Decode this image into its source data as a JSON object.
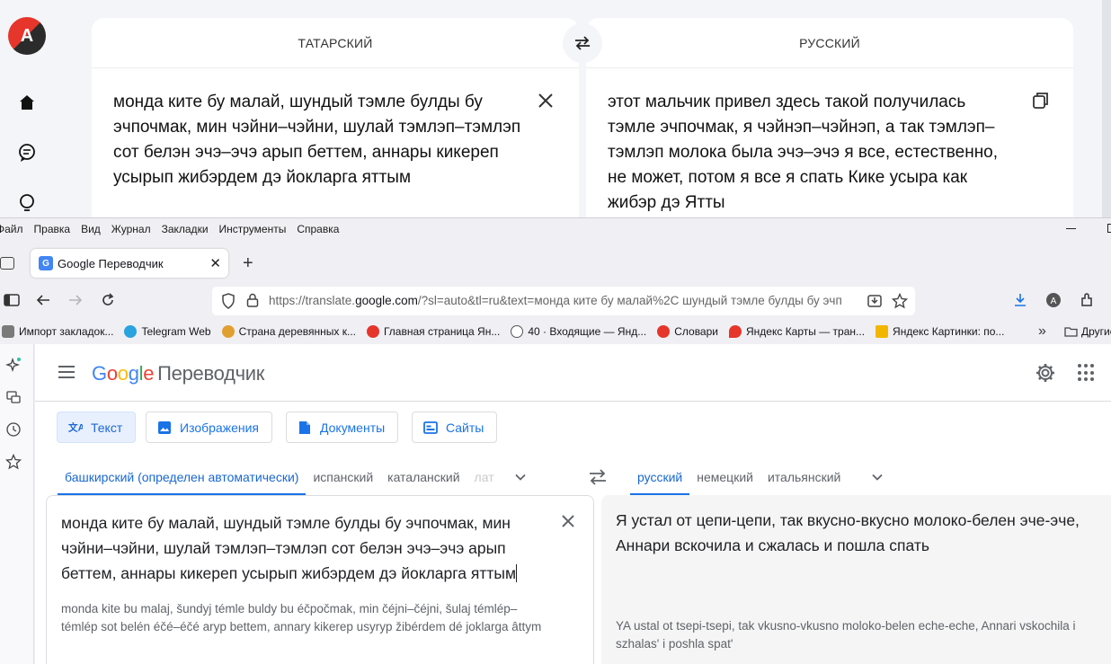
{
  "yandex": {
    "source_lang": "ТАТАРСКИЙ",
    "target_lang": "РУССКИЙ",
    "source_text": "монда ките бу малай, шундый тэмле булды бу эчпочмак, мин чэйни–чэйни, шулай тэмлэп–тэмлэп сот белэн эчэ–эчэ арып беттем, аннары кикереп усырып жибэрдем дэ йокларга яттым",
    "target_text": "этот мальчик привел здесь такой получилась тэмле эчпочмак, я чэйнэп–чэйнэп, а так тэмлэп–тэмлэп молока была эчэ–эчэ я все, естественно, не может, потом я все я спать Кике усыра как жибэр дэ Ятты"
  },
  "firefox": {
    "menu": [
      "Файл",
      "Правка",
      "Вид",
      "Журнал",
      "Закладки",
      "Инструменты",
      "Справка"
    ],
    "tab_title": "Google Переводчик",
    "url_prefix": "https://translate.",
    "url_host": "google.com",
    "url_rest": "/?sl=auto&tl=ru&text=монда ките бу малай%2C шундый тэмле булды бу эчп",
    "bookmarks": [
      {
        "label": "Импорт закладок...",
        "color": "#7a7a7a"
      },
      {
        "label": "Telegram Web",
        "color": "#2aa3df"
      },
      {
        "label": "Страна деревянных к...",
        "color": "#e0a030"
      },
      {
        "label": "Главная страница Ян...",
        "color": "#e6352b"
      },
      {
        "label": "40 · Входящие — Янд...",
        "color": "#555555"
      },
      {
        "label": "Словари",
        "color": "#e6352b"
      },
      {
        "label": "Яндекс Карты — тран...",
        "color": "#e6352b"
      },
      {
        "label": "Яндекс Картинки: по...",
        "color": "#f2b600"
      }
    ],
    "bookmarks_other": "Другие"
  },
  "google": {
    "logo": "Google",
    "product": "Переводчик",
    "modes": [
      "Текст",
      "Изображения",
      "Документы",
      "Сайты"
    ],
    "source_langs": [
      "башкирский (определен автоматически)",
      "испанский",
      "каталанский",
      "лат"
    ],
    "target_langs": [
      "русский",
      "немецкий",
      "итальянский"
    ],
    "source_text": "монда ките бу малай, шундый тэмле булды бу эчпочмак, мин чэйни–чэйни, шулай тэмлэп–тэмлэп сот белэн эчэ–эчэ арып беттем, аннары кикереп усырып жибэрдем дэ йокларга яттым",
    "source_translit": "monda kite bu malaj, šundyj témle buldy bu éčpočmak, min čéjni–čéjni, šulaj témlép–témlép sot belén éčé–éčé aryp bettem, annary kikerep usyryp žibérdem dé joklarga âttym",
    "target_text": "Я устал от цепи-цепи, так вкусно-вкусно молоко-белен эче-эче, Аннари вскочила и сжалась и пошла спать",
    "target_translit": "YA ustal ot tsepi-tsepi, tak vkusno-vkusno moloko-belen eche-eche, Annari vskochila i szhalas' i poshla spat'"
  }
}
